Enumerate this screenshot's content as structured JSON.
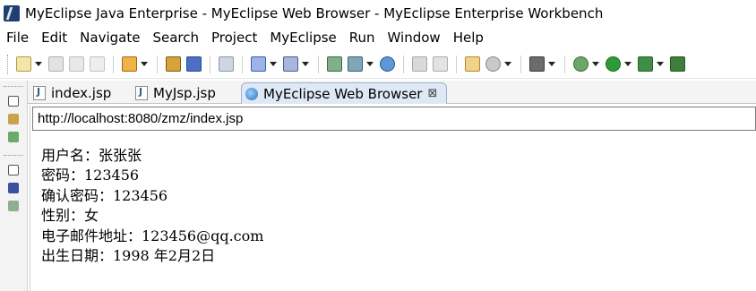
{
  "window": {
    "title": "MyEclipse Java Enterprise - MyEclipse Web Browser - MyEclipse Enterprise Workbench"
  },
  "menu": [
    "File",
    "Edit",
    "Navigate",
    "Search",
    "Project",
    "MyEclipse",
    "Run",
    "Window",
    "Help"
  ],
  "tabs": [
    {
      "label": "index.jsp"
    },
    {
      "label": "MyJsp.jsp"
    },
    {
      "label": "MyEclipse Web Browser",
      "close": "⊠"
    }
  ],
  "browser": {
    "url": "http://localhost:8080/zmz/index.jsp"
  },
  "page": {
    "lines": [
      "用户名：张张张",
      "密码：123456",
      "确认密码：123456",
      "性别：女",
      "电子邮件地址：123456@qq.com",
      "出生日期：1998 年2月2日"
    ]
  }
}
